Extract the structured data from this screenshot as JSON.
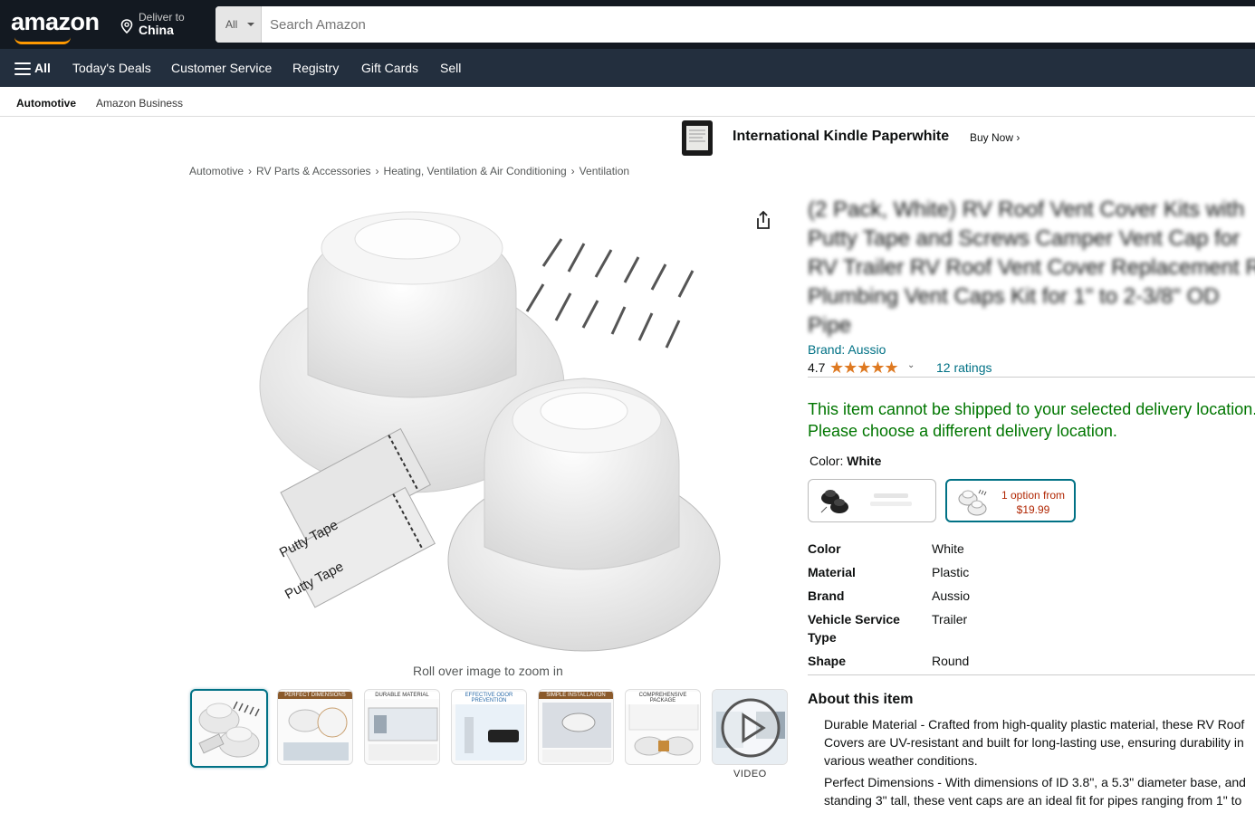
{
  "header": {
    "logo": "amazon",
    "deliver_to_label": "Deliver to",
    "deliver_to_value": "China",
    "search_category": "All",
    "search_placeholder": "Search Amazon"
  },
  "nav": {
    "all_label": "All",
    "items": [
      "Today's Deals",
      "Customer Service",
      "Registry",
      "Gift Cards",
      "Sell"
    ]
  },
  "subnav": {
    "items": [
      "Automotive",
      "Amazon Business"
    ]
  },
  "ad": {
    "title": "International Kindle Paperwhite",
    "cta": "Buy Now ›"
  },
  "breadcrumbs": [
    "Automotive",
    "RV Parts & Accessories",
    "Heating, Ventilation & Air Conditioning",
    "Ventilation"
  ],
  "gallery": {
    "main_image_icon": "rv-vent-cover-kit-image",
    "putty_label": "Putty Tape",
    "zoom_hint": "Roll over image to zoom in",
    "thumb_captions": [
      "",
      "PERFECT DIMENSIONS",
      "DURABLE MATERIAL",
      "EFFECTIVE ODOR PREVENTION",
      "SIMPLE INSTALLATION",
      "COMPREHENSIVE PACKAGE",
      ""
    ],
    "video_label": "VIDEO"
  },
  "product": {
    "title_lines": [
      "(2 Pack, White) RV Roof Vent Cover Kits with",
      "Putty Tape and Screws Camper Vent Cap for",
      "RV Trailer RV Roof Vent Cover Replacement R",
      "Plumbing Vent Caps Kit for 1\" to 2-3/8\" OD",
      "Pipe"
    ],
    "brand": "Brand: Aussio",
    "rating_value": "4.7",
    "rating_stars": 4.7,
    "rating_count": "12 ratings",
    "notice_line1": "This item cannot be shipped to your selected delivery location.",
    "notice_line2": "Please choose a different delivery location.",
    "color_label": "Color:",
    "color_value": "White",
    "swatch_selected_line1": "1 option from",
    "swatch_selected_line2": "$19.99",
    "specs": [
      {
        "k": "Color",
        "v": "White"
      },
      {
        "k": "Material",
        "v": "Plastic"
      },
      {
        "k": "Brand",
        "v": "Aussio"
      },
      {
        "k": "Vehicle Service Type",
        "v": "Trailer"
      },
      {
        "k": "Shape",
        "v": "Round"
      }
    ],
    "about_title": "About this item",
    "bullets": [
      [
        "Durable Material - Crafted from high-quality plastic material, these RV Roof",
        "Covers are UV-resistant and built for long-lasting use, ensuring durability in",
        "various weather conditions."
      ],
      [
        "Perfect Dimensions - With dimensions of ID 3.8\", a 5.3\" diameter base, and",
        "standing 3\" tall, these vent caps are an ideal fit for pipes ranging from 1\" to"
      ]
    ]
  },
  "colors": {
    "topbar": "#131921",
    "navbar": "#232f3e",
    "accent": "#ff9900",
    "link": "#007185",
    "star": "#de7921",
    "notice": "#007600",
    "price": "#b12704"
  }
}
